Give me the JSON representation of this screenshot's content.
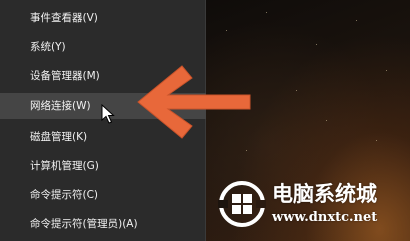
{
  "menu": {
    "items": [
      {
        "label": "事件查看器(V)"
      },
      {
        "label": "系统(Y)"
      },
      {
        "label": "设备管理器(M)"
      },
      {
        "label": "网络连接(W)"
      },
      {
        "label": "磁盘管理(K)"
      },
      {
        "label": "计算机管理(G)"
      },
      {
        "label": "命令提示符(C)"
      },
      {
        "label": "命令提示符(管理员)(A)"
      }
    ],
    "highlighted_item": "网络连接(W)"
  },
  "annotation": {
    "icon": "left-arrow-icon",
    "color": "#e8683a"
  },
  "cursor": {
    "icon": "mouse-pointer-icon"
  },
  "watermark": {
    "title": "电脑系统城",
    "url": "www.dnxtc.net",
    "icon": "windows-logo-icon",
    "color": "#ffffff"
  },
  "colors": {
    "menu_background": "#2b2b2b",
    "menu_hover": "#454545",
    "menu_text": "#f2f2f2"
  }
}
